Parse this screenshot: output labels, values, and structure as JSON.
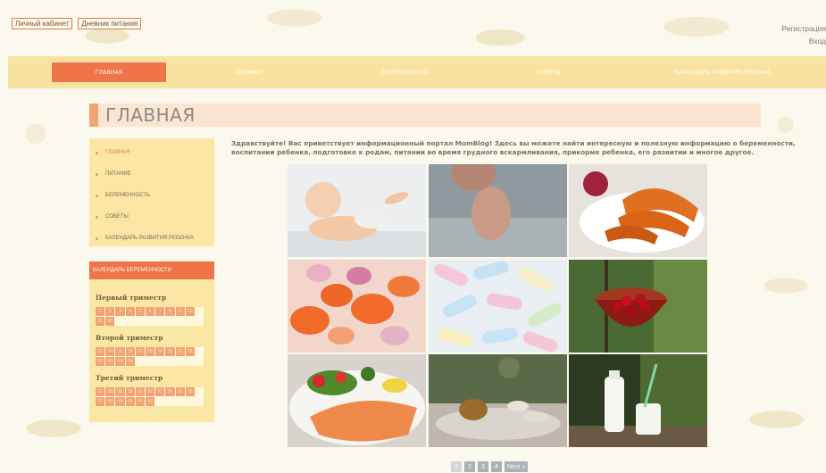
{
  "header": {
    "links": [
      "Личный кабинет",
      "Дневник питания"
    ],
    "register": "Регистрация",
    "login": "Вход"
  },
  "nav": {
    "items": [
      {
        "label": "ГЛАВНАЯ",
        "active": true
      },
      {
        "label": "ПИТАНИЕ",
        "active": false
      },
      {
        "label": "БЕРЕМЕННОСТЬ",
        "active": false
      },
      {
        "label": "СОВЕТЫ",
        "active": false
      },
      {
        "label": "КАЛЕНДАРЬ РАЗВИТИЯ РЕБЕНКА",
        "active": false
      }
    ]
  },
  "page": {
    "title": "ГЛАВНАЯ",
    "intro": "Здравствуйте! Вас приветствует информационный портал MomBlog! Здесь вы можете найти интересную и полезную информацию о беременности, воспитании ребенка, подготовке к родам, питании во время грудного вскармливания, прикорме ребенка, его развитии и многое другое."
  },
  "sidebar": {
    "menu": [
      {
        "label": "ГЛАВНАЯ",
        "active": true
      },
      {
        "label": "ПИТАНИЕ",
        "active": false
      },
      {
        "label": "БЕРЕМЕННОСТЬ",
        "active": false
      },
      {
        "label": "СОВЕТЫ",
        "active": false
      },
      {
        "label": "КАЛЕНДАРЬ РАЗВИТИЯ РЕБЕНКА",
        "active": false
      }
    ],
    "calendar": {
      "title": "КАЛЕНДАРЬ БЕРЕМЕННОСТИ",
      "trimesters": [
        {
          "label": "Первый триместр",
          "weeks": [
            "1",
            "2",
            "3",
            "4",
            "5",
            "6",
            "7",
            "8",
            "9",
            "10",
            "11",
            "12"
          ]
        },
        {
          "label": "Второй триместр",
          "weeks": [
            "13",
            "14",
            "15",
            "16",
            "17",
            "18",
            "19",
            "20",
            "21",
            "22",
            "23",
            "24",
            "25",
            "26"
          ]
        },
        {
          "label": "Третий триместр",
          "weeks": [
            "27",
            "28",
            "29",
            "30",
            "31",
            "32",
            "33",
            "34",
            "35",
            "36",
            "37",
            "38",
            "39",
            "40",
            "41",
            "42"
          ]
        }
      ]
    }
  },
  "gallery": {
    "photos": [
      "baby-icon",
      "baby-feet-icon",
      "baked-pumpkin-icon",
      "vitamin-pills-icon",
      "marshmallows-icon",
      "cherries-basket-icon",
      "salmon-salad-icon",
      "tea-set-icon",
      "milk-bottles-icon"
    ]
  },
  "pagination": {
    "pages": [
      "1",
      "2",
      "3",
      "4"
    ],
    "current": "1",
    "next": "Next »"
  },
  "colors": {
    "accent": "#ef7448",
    "nav": "#f8e4a0",
    "sidebar": "#fae7a5"
  }
}
